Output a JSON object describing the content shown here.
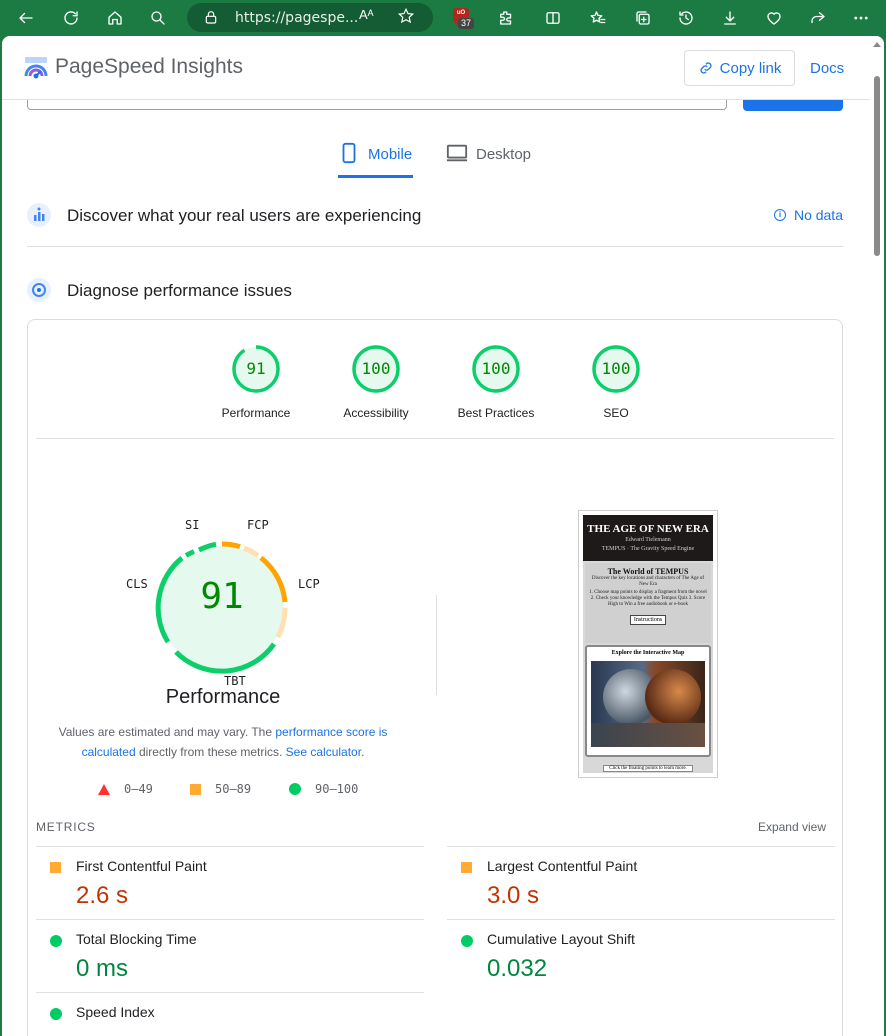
{
  "browser": {
    "url": "https://pagespe...",
    "read_aloud": "Aᴬ",
    "extension_badge": "37",
    "extension_label": "uO"
  },
  "header": {
    "brand": "PageSpeed Insights",
    "copy_link": "Copy link",
    "docs": "Docs"
  },
  "tabs": [
    {
      "label": "Mobile",
      "active": true
    },
    {
      "label": "Desktop",
      "active": false
    }
  ],
  "sections": {
    "real_users": "Discover what your real users are experiencing",
    "no_data": "No data",
    "diagnose": "Diagnose performance issues"
  },
  "scores": [
    {
      "label": "Performance",
      "value": "91"
    },
    {
      "label": "Accessibility",
      "value": "100"
    },
    {
      "label": "Best Practices",
      "value": "100"
    },
    {
      "label": "SEO",
      "value": "100"
    }
  ],
  "performance": {
    "score": "91",
    "title": "Performance",
    "segments": {
      "si": "SI",
      "fcp": "FCP",
      "lcp": "LCP",
      "tbt": "TBT",
      "cls": "CLS"
    },
    "disclaimer_pre": "Values are estimated and may vary. The ",
    "disclaimer_link1": "performance score is calculated",
    "disclaimer_mid": " directly from these metrics. ",
    "disclaimer_link2": "See calculator",
    "disclaimer_post": "."
  },
  "legend": {
    "fail": "0–49",
    "average": "50–89",
    "pass": "90–100"
  },
  "screenshot": {
    "title": "THE AGE OF NEW ERA",
    "author": "Edward Tielemann",
    "subtitle": "TEMPUS · The Gravity Speed Engine",
    "world_heading": "The World of TEMPUS",
    "world_text": "Discover the key locations and characters of The Age of New Era",
    "steps": "1. Choose map points to display a fragment from the novel  2. Check your knowledge with the Tempus Quiz  3. Score High to Win a free audiobook or e-book",
    "instructions": "Instructions",
    "map_heading": "Explore the Interactive Map",
    "footer": "Click the floating points to learn more."
  },
  "metrics": {
    "heading": "METRICS",
    "expand": "Expand view",
    "items": [
      {
        "name": "First Contentful Paint",
        "value": "2.6 s",
        "status": "average"
      },
      {
        "name": "Largest Contentful Paint",
        "value": "3.0 s",
        "status": "average"
      },
      {
        "name": "Total Blocking Time",
        "value": "0 ms",
        "status": "pass"
      },
      {
        "name": "Cumulative Layout Shift",
        "value": "0.032",
        "status": "pass"
      },
      {
        "name": "Speed Index",
        "value": "",
        "status": "pass"
      }
    ]
  },
  "colors": {
    "pass": "#0cce6b",
    "average": "#ffa400",
    "fail": "#ff4e42",
    "accent": "#1a73e8"
  }
}
